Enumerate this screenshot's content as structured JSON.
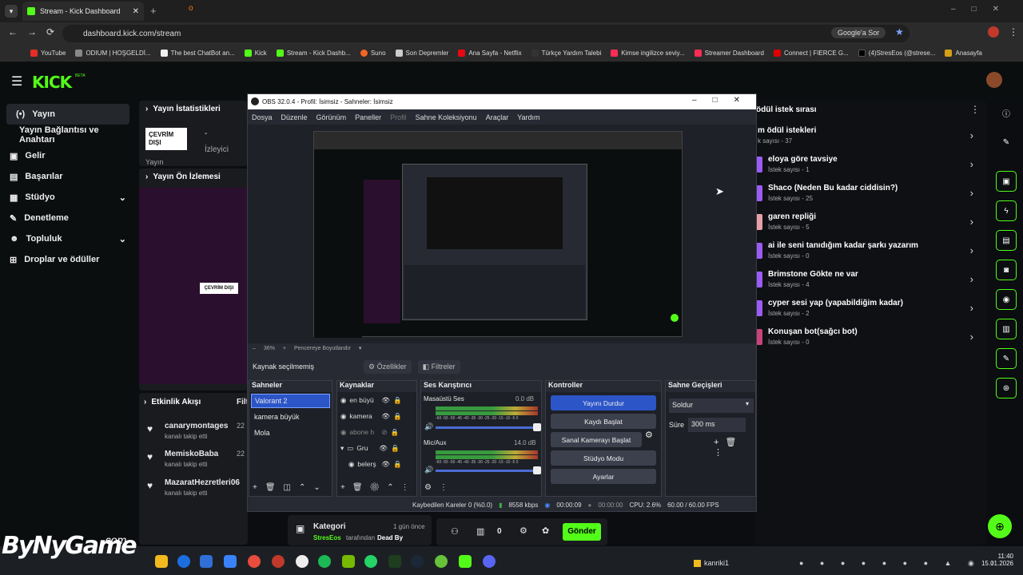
{
  "browser": {
    "tab_title": "Stream - Kick Dashboard",
    "url": "dashboard.kick.com/stream",
    "google_btn": "Google'a Sor"
  },
  "bookmarks": [
    "YouTube",
    "ODIUM | HOŞGELDİ...",
    "The best ChatBot an...",
    "Kick",
    "Stream - Kick Dashb...",
    "Suno",
    "Son Depremler",
    "Ana Sayfa - Netflix",
    "Türkçe Yardım Talebi",
    "Kimse ingilizce seviy...",
    "Streamer Dashboard",
    "Connect | FIERCE G...",
    "(4)StresEos (@strese...",
    "Anasayfa"
  ],
  "kick": {
    "logo": "KICK",
    "beta": "BETA",
    "sidebar": [
      {
        "label": "Yayın",
        "icon": "broadcast-icon"
      },
      {
        "label": "Yayın Bağlantısı ve Anahtarı",
        "icon": ""
      },
      {
        "label": "Gelir",
        "icon": "dollar-icon"
      },
      {
        "label": "Başarılar",
        "icon": "trophy-icon"
      },
      {
        "label": "Stüdyo",
        "icon": "studio-icon"
      },
      {
        "label": "Denetleme",
        "icon": "wrench-icon"
      },
      {
        "label": "Topluluk",
        "icon": "people-icon"
      },
      {
        "label": "Droplar ve ödüller",
        "icon": "gift-icon"
      }
    ],
    "stats_title": "Yayın İstatistikleri",
    "offline_badge": "ÇEVRİM DIŞI",
    "dash": "-",
    "viewers_label": "İzleyici",
    "yayin_label": "Yayın",
    "preview_title": "Yayın Ön İzlemesi",
    "preview_offline": "ÇEVRİM DIŞI",
    "activity_title": "Etkinlik Akışı",
    "activity_filter": "Filt",
    "activity": [
      {
        "name": "canarymontages",
        "action": "kanalı takip etti",
        "time": "22"
      },
      {
        "name": "MemiskoBaba",
        "action": "kanalı takip etti",
        "time": "22"
      },
      {
        "name": "MazaratHezretleri06",
        "action": "kanalı takip etti",
        "time": "22"
      }
    ],
    "category": {
      "label": "Kategori",
      "time": "1 gün önce",
      "by_user": "StresEos",
      "by_text": "tarafından",
      "game": "Dead By"
    },
    "chat": {
      "count": "0",
      "send": "Gönder"
    },
    "rewards_title": "ödül istek sırası",
    "rewards": [
      {
        "title": "m ödül istekleri",
        "sub": "k sayısı - 37"
      },
      {
        "title": "eloya göre tavsiye",
        "sub": "İstek sayısı - 1"
      },
      {
        "title": "Shaco (Neden Bu kadar ciddisin?)",
        "sub": "İstek sayısı - 25"
      },
      {
        "title": "garen repliği",
        "sub": "İstek sayısı - 5"
      },
      {
        "title": "ai ile seni tanıdığım kadar şarkı yazarım",
        "sub": "İstek sayısı - 0"
      },
      {
        "title": "Brimstone Gökte ne var",
        "sub": "İstek sayısı - 4"
      },
      {
        "title": "cyper sesi yap (yapabildiğim kadar)",
        "sub": "İstek sayısı - 2"
      },
      {
        "title": "Konuşan bot(sağcı bot)",
        "sub": "İstek sayısı - 0"
      }
    ]
  },
  "obs": {
    "title": "OBS 32.0.4 - Profil: İsimsiz - Sahneler: İsimsiz",
    "menu": [
      "Dosya",
      "Düzenle",
      "Görünüm",
      "Paneller",
      "Profil",
      "Sahne Koleksiyonu",
      "Araçlar",
      "Yardım"
    ],
    "zoom": "36%",
    "fit": "Pencereye Boyutlandır",
    "no_source": "Kaynak seçilmemiş",
    "properties": "Özellikler",
    "filters": "Filtreler",
    "docks": {
      "scenes": "Sahneler",
      "sources": "Kaynaklar",
      "mixer": "Ses Karıştırıcı",
      "controls": "Kontroller",
      "transitions": "Sahne Geçişleri"
    },
    "scenes": [
      "Valorant 2",
      "kamera büyük",
      "Mola"
    ],
    "sources": [
      "en büyü",
      "kamera",
      "abone h",
      "Gru",
      "belerş"
    ],
    "mixer": [
      {
        "name": "Masaüstü Ses",
        "db": "0.0 dB"
      },
      {
        "name": "Mic/Aux",
        "db": "14.0 dB"
      }
    ],
    "meter_scale": "-60 -55 -50 -45 -40 -35 -30 -25 -20 -15 -10 -5 0",
    "controls": [
      "Yayını Durdur",
      "Kaydı Başlat",
      "Sanal Kamerayı Başlat",
      "Stüdyo Modu",
      "Ayarlar"
    ],
    "transition": "Soldur",
    "duration_label": "Süre",
    "duration": "300 ms",
    "status": {
      "dropped": "Kaybedilen Kareler 0 (%0.0)",
      "kbps": "8558 kbps",
      "live_time": "00:00:09",
      "rec_time": "00:00:00",
      "cpu": "CPU: 2.6%",
      "fps": "60.00 / 60.00 FPS"
    }
  },
  "taskbar": {
    "time": "11:40",
    "date": "15.01.2026",
    "user": "kanriki1"
  },
  "watermark": {
    "text": "ByNyGame",
    "com": ".com"
  }
}
